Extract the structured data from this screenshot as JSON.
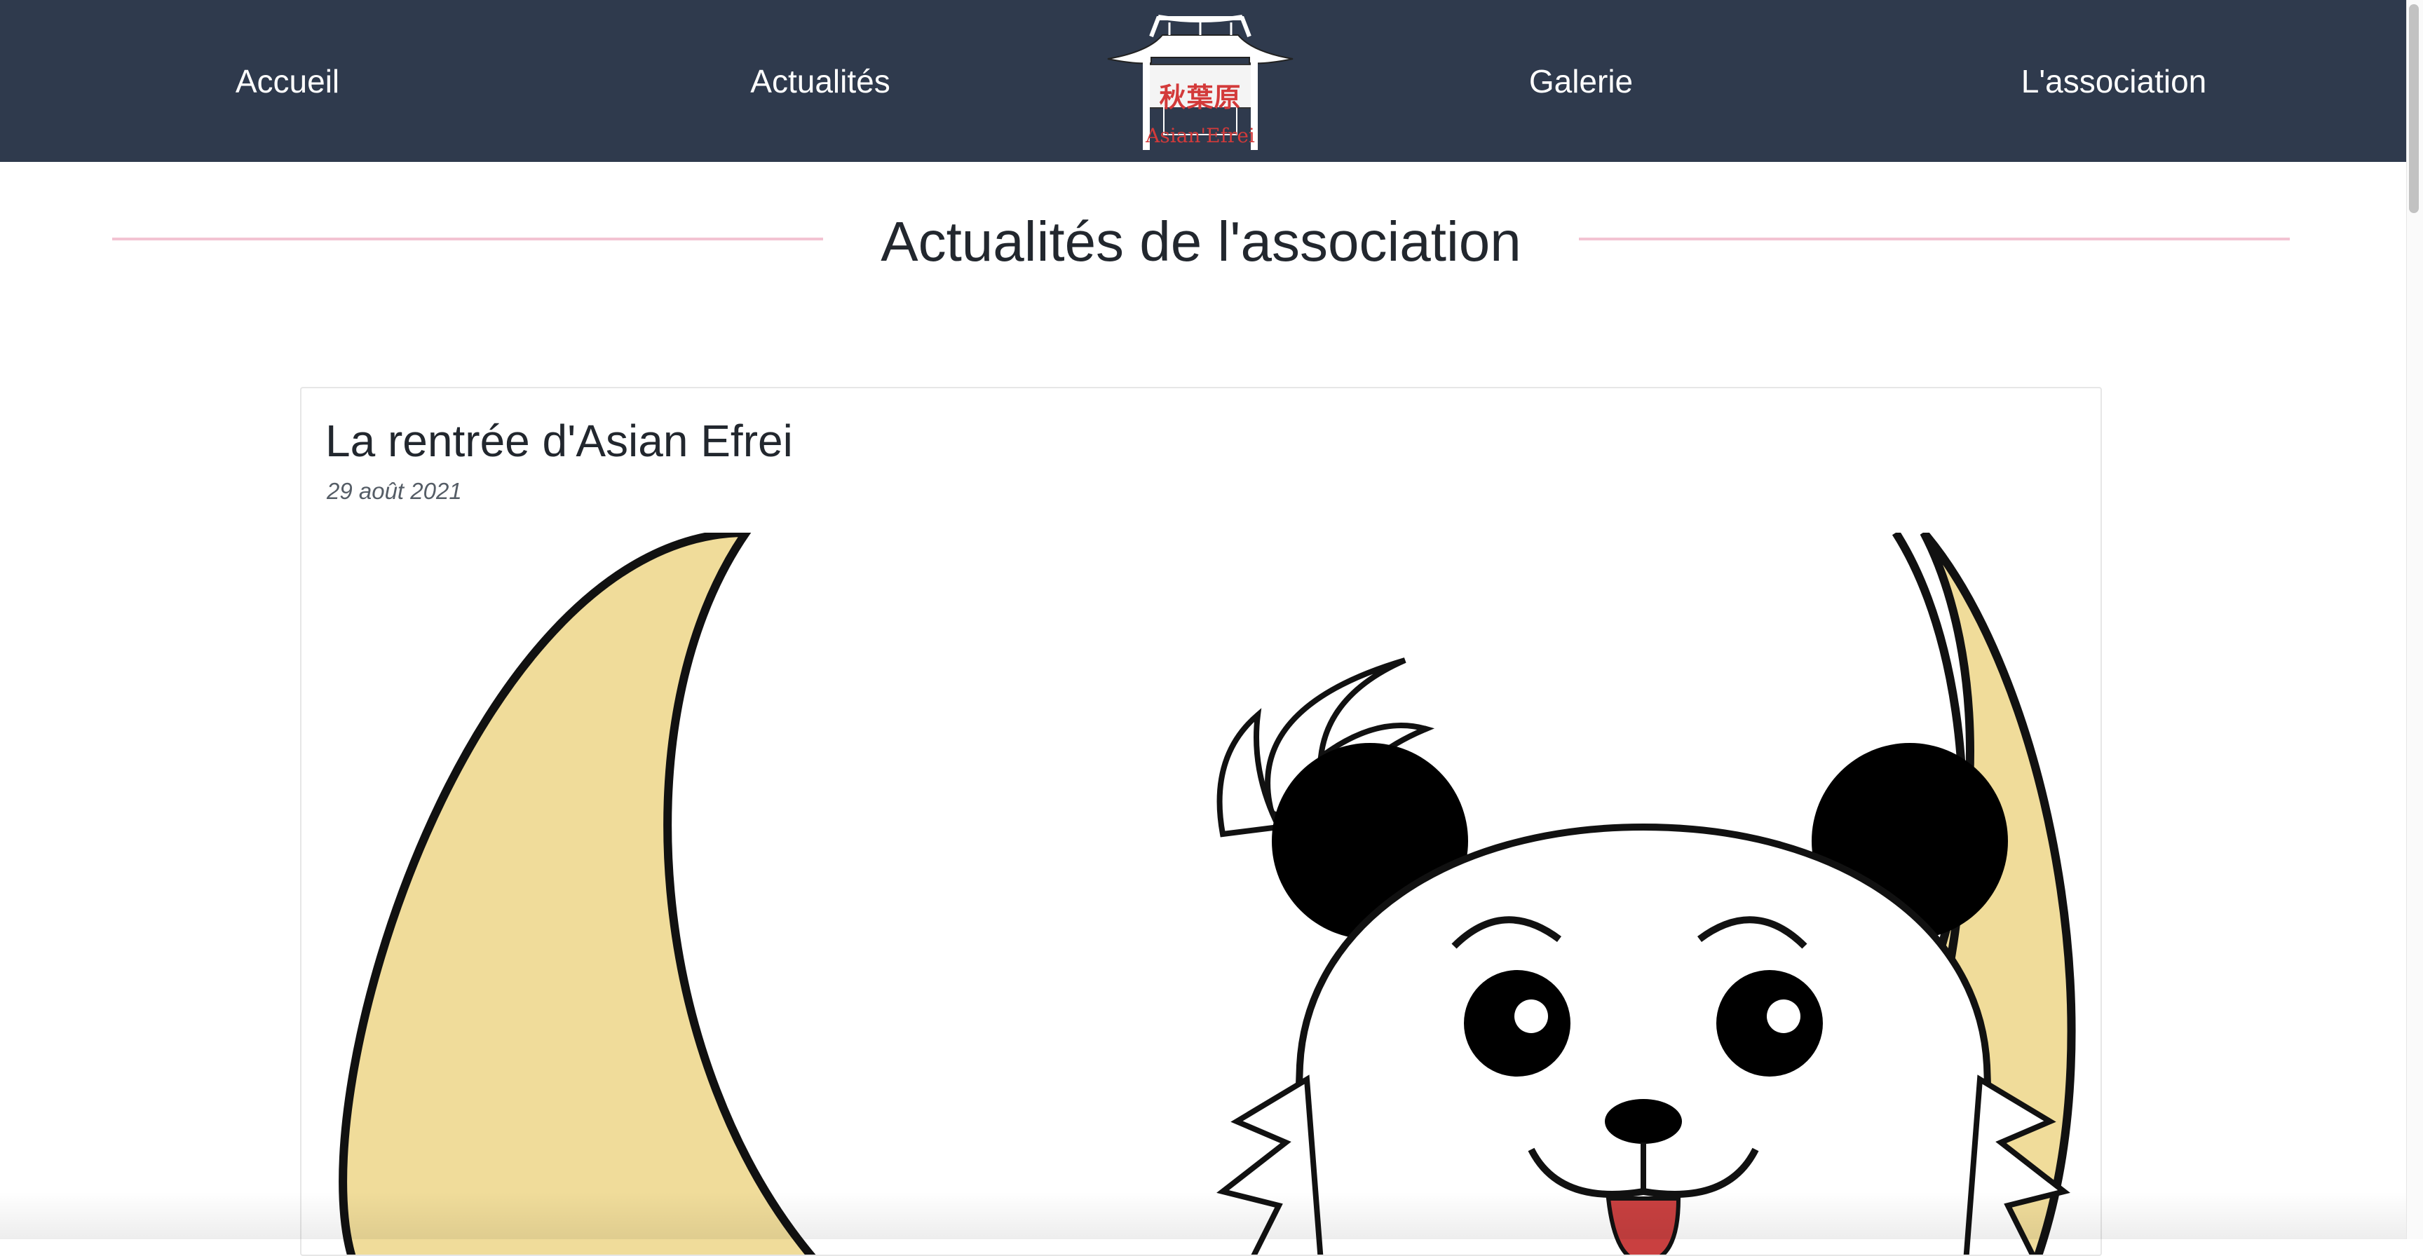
{
  "nav": {
    "links": [
      "Accueil",
      "Actualités",
      "Galerie",
      "L'association"
    ],
    "logo": {
      "kanji": "秋葉原",
      "name": "Asian'Efrei"
    },
    "background_color": "#2f3a4d"
  },
  "page": {
    "title": "Actualités de l'association",
    "accent_line_color": "#f3c3d2"
  },
  "article": {
    "title": "La rentrée d'Asian Efrei",
    "date": "29 août 2021",
    "image_icon": "panda-mascot-moon-illustration",
    "moon_color": "#f0dc9a"
  }
}
